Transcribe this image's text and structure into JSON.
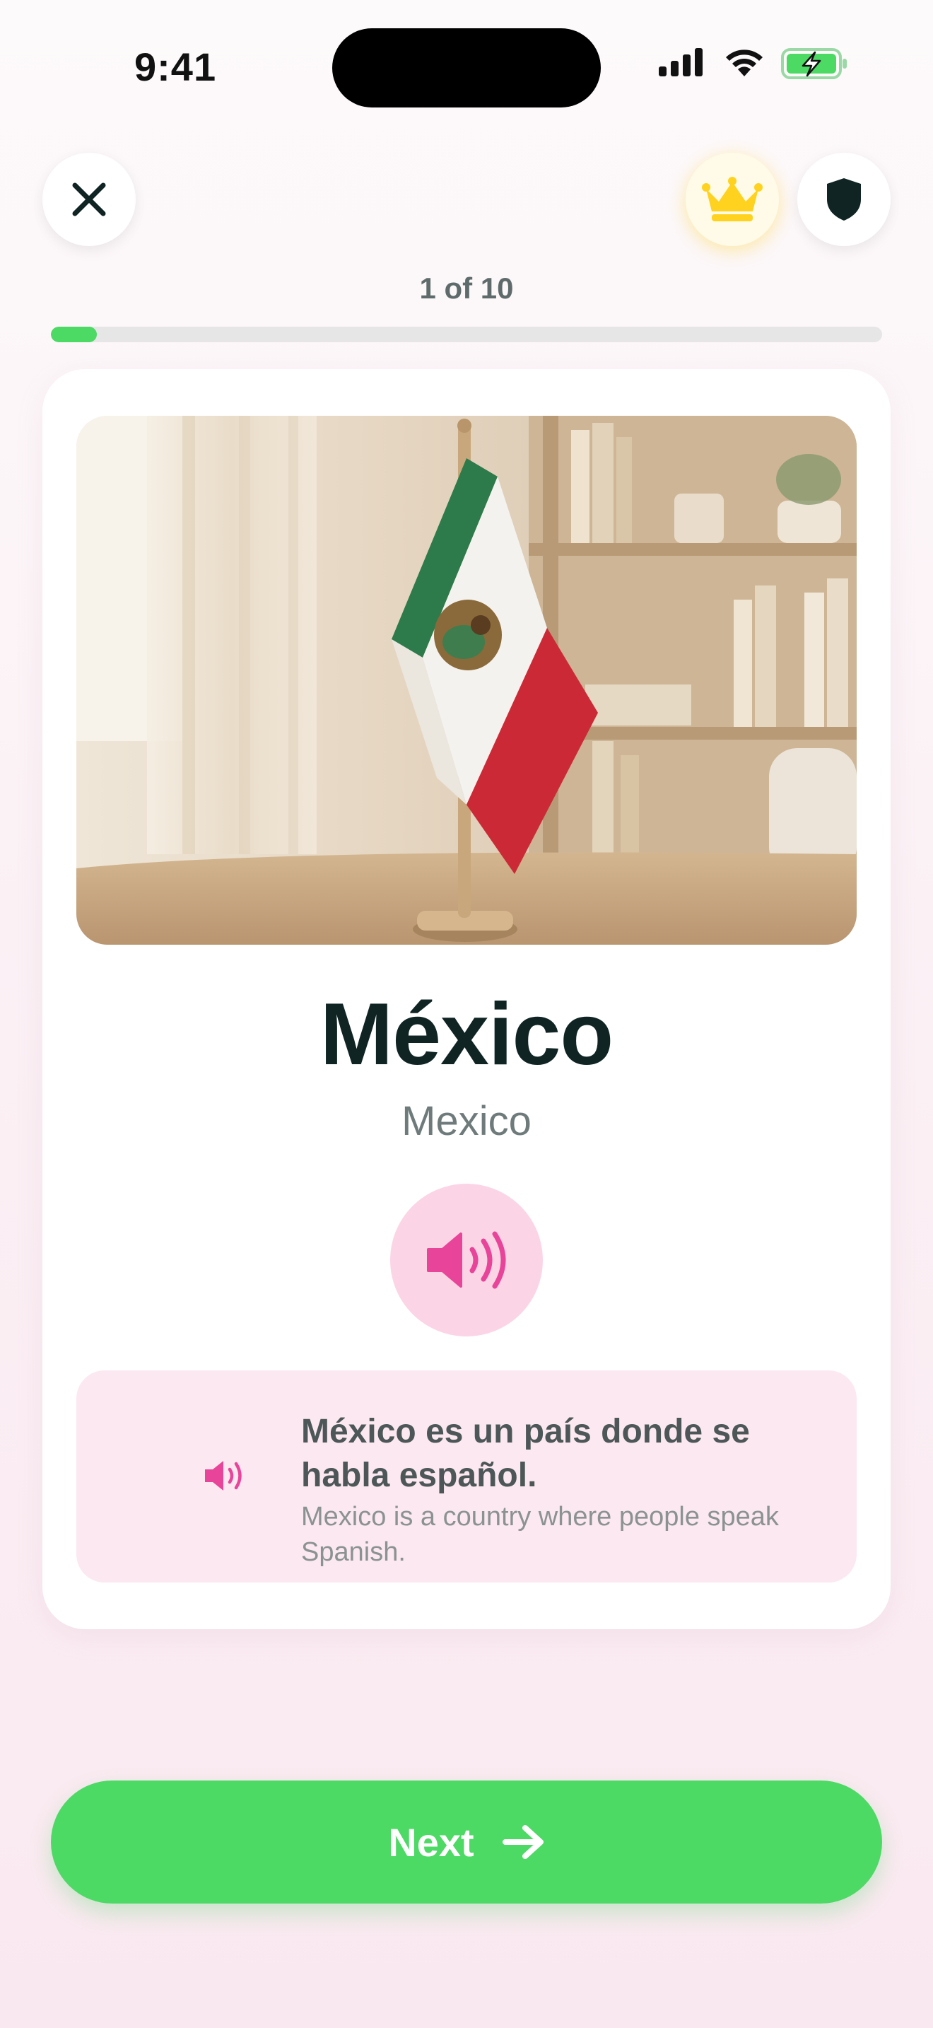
{
  "status_bar": {
    "time": "9:41"
  },
  "header": {
    "close_icon": "close-icon",
    "premium_icon": "crown-icon",
    "shield_icon": "shield-icon",
    "progress_label": "1 of 10",
    "progress_fraction": 0.055
  },
  "card": {
    "image_alt": "Mexican flag on a wooden desk stand",
    "word": "México",
    "translation": "Mexico",
    "audio_icon": "speaker-icon",
    "example": {
      "sentence": "México es un país donde se habla español.",
      "translation": "Mexico is a country where people speak Spanish."
    }
  },
  "footer": {
    "next_label": "Next",
    "next_icon": "arrow-right-icon"
  },
  "colors": {
    "accent_green": "#4cd964",
    "accent_pink": "#e8449a",
    "crown_gold": "#ffd21f",
    "text_dark": "#102424"
  }
}
